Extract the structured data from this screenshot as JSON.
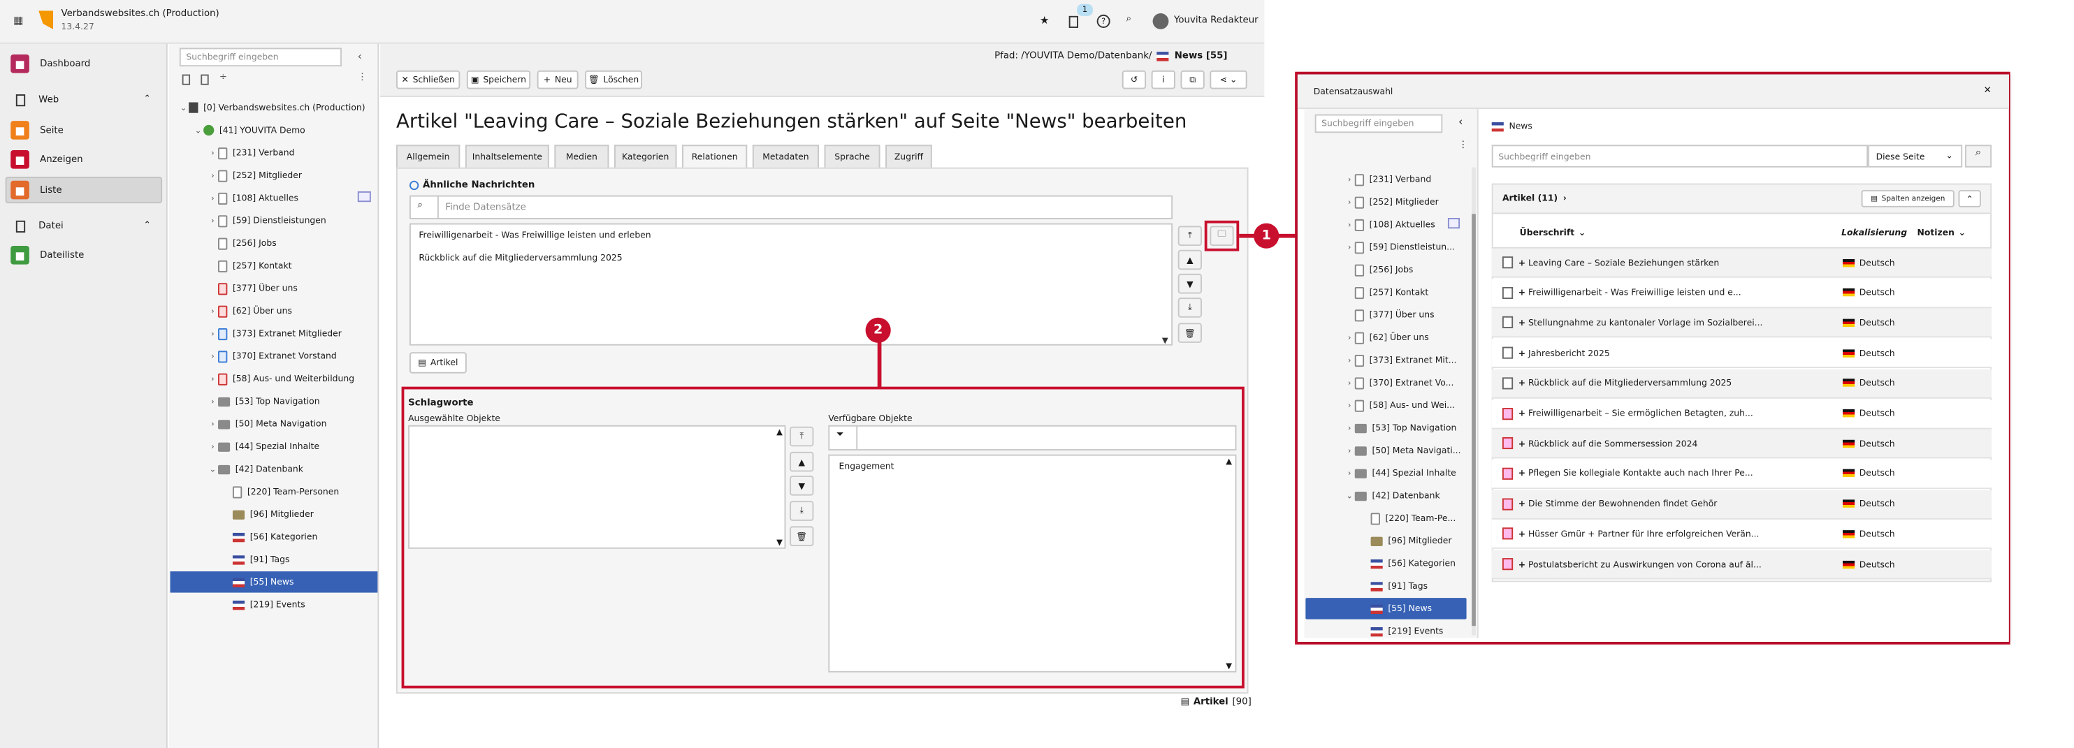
{
  "topbar": {
    "site_name": "Verbandswebsites.ch (Production)",
    "version": "13.4.27",
    "notif_count": "1",
    "user": "Youvita Redakteur"
  },
  "modules": [
    {
      "label": "Dashboard",
      "color": "#b52a5c",
      "icon": "dashboard-icon"
    },
    {
      "label": "Web",
      "color": "",
      "icon": "web-icon"
    },
    {
      "label": "Seite",
      "color": "#f0801a",
      "icon": "page-icon"
    },
    {
      "label": "Anzeigen",
      "color": "#c8102e",
      "icon": "eye-icon"
    },
    {
      "label": "Liste",
      "color": "#e26a2a",
      "icon": "list-icon"
    },
    {
      "label": "Datei",
      "color": "",
      "icon": "file-icon"
    },
    {
      "label": "Dateiliste",
      "color": "#3f9b3f",
      "icon": "filelist-icon"
    }
  ],
  "pagetree": {
    "search_placeholder": "Suchbegriff eingeben",
    "items": [
      {
        "label": "[0] Verbandswebsites.ch (Production)",
        "level": 0,
        "icon": "typo3-icon",
        "chev": "v"
      },
      {
        "label": "[41] YOUVITA Demo",
        "level": 1,
        "icon": "globe-icon",
        "chev": "v"
      },
      {
        "label": "[231] Verband",
        "level": 2,
        "icon": "page-icon",
        "chev": ">"
      },
      {
        "label": "[252] Mitglieder",
        "level": 2,
        "icon": "page-icon",
        "chev": ">"
      },
      {
        "label": "[108] Aktuelles",
        "level": 2,
        "icon": "page-icon",
        "chev": ">"
      },
      {
        "label": "[59] Dienstleistungen",
        "level": 2,
        "icon": "page-icon",
        "chev": ">"
      },
      {
        "label": "[256] Jobs",
        "level": 2,
        "icon": "page-icon",
        "chev": ""
      },
      {
        "label": "[257] Kontakt",
        "level": 2,
        "icon": "page-icon",
        "chev": ""
      },
      {
        "label": "[377] Über uns",
        "level": 2,
        "icon": "restricted-page-icon",
        "chev": ""
      },
      {
        "label": "[62] Über uns",
        "level": 2,
        "icon": "restricted-page-icon",
        "chev": ">"
      },
      {
        "label": "[373] Extranet Mitglieder",
        "level": 2,
        "icon": "extranet-icon",
        "chev": ">"
      },
      {
        "label": "[370] Extranet Vorstand",
        "level": 2,
        "icon": "extranet-icon",
        "chev": ">"
      },
      {
        "label": "[58] Aus- und Weiterbildung",
        "level": 2,
        "icon": "restricted-page-icon",
        "chev": ">"
      },
      {
        "label": "[53] Top Navigation",
        "level": 2,
        "icon": "folder-icon",
        "chev": ">"
      },
      {
        "label": "[50] Meta Navigation",
        "level": 2,
        "icon": "folder-icon",
        "chev": ">"
      },
      {
        "label": "[44] Spezial Inhalte",
        "level": 2,
        "icon": "folder-icon",
        "chev": ">"
      },
      {
        "label": "[42] Datenbank",
        "level": 2,
        "icon": "folder-icon",
        "chev": "v"
      },
      {
        "label": "[220] Team-Personen",
        "level": 3,
        "icon": "page-icon",
        "chev": ""
      },
      {
        "label": "[96] Mitglieder",
        "level": 3,
        "icon": "users-folder-icon",
        "chev": ""
      },
      {
        "label": "[56] Kategorien",
        "level": 3,
        "icon": "news-folder-icon",
        "chev": ""
      },
      {
        "label": "[91] Tags",
        "level": 3,
        "icon": "news-folder-icon",
        "chev": ""
      },
      {
        "label": "[55] News",
        "level": 3,
        "icon": "news-folder-icon",
        "chev": "",
        "selected": true
      },
      {
        "label": "[219] Events",
        "level": 3,
        "icon": "news-folder-icon",
        "chev": ""
      }
    ]
  },
  "doc": {
    "path_prefix": "Pfad: /YOUVITA Demo/Datenbank/",
    "path_page": "News [55]",
    "buttons": {
      "close": "Schließen",
      "save": "Speichern",
      "new": "Neu",
      "delete": "Löschen"
    },
    "title": "Artikel \"Leaving Care – Soziale Beziehungen stärken\" auf Seite \"News\" bearbeiten",
    "tabs": [
      "Allgemein",
      "Inhaltselemente",
      "Medien",
      "Kategorien",
      "Relationen",
      "Metadaten",
      "Sprache",
      "Zugriff"
    ],
    "active_tab": "Relationen",
    "related": {
      "label": "Ähnliche Nachrichten",
      "placeholder": "Finde Datensätze",
      "items": [
        "Freiwilligenarbeit - Was Freiwillige leisten und erleben",
        "Rückblick auf die Mitgliederversammlung 2025"
      ],
      "add_button": "Artikel"
    },
    "tags": {
      "label": "Schlagworte",
      "selected_label": "Ausgewählte Objekte",
      "available_label": "Verfügbare Objekte",
      "available_items": [
        "Engagement"
      ]
    },
    "footer_label": "Artikel",
    "footer_count": "[90]"
  },
  "badges": {
    "b1": "1",
    "b2": "2"
  },
  "modal": {
    "title": "Datensatzauswahl",
    "search_placeholder": "Suchbegriff eingeben",
    "tree": [
      {
        "label": "[231] Verband",
        "chev": ">"
      },
      {
        "label": "[252] Mitglieder",
        "chev": ">"
      },
      {
        "label": "[108] Aktuelles",
        "chev": ">"
      },
      {
        "label": "[59] Dienstleistun...",
        "chev": ">"
      },
      {
        "label": "[256] Jobs",
        "chev": ""
      },
      {
        "label": "[257] Kontakt",
        "chev": ""
      },
      {
        "label": "[377] Über uns",
        "chev": ""
      },
      {
        "label": "[62] Über uns",
        "chev": ">"
      },
      {
        "label": "[373] Extranet Mit...",
        "chev": ">"
      },
      {
        "label": "[370] Extranet Vo...",
        "chev": ">"
      },
      {
        "label": "[58] Aus- und Wei...",
        "chev": ">"
      },
      {
        "label": "[53] Top Navigation",
        "chev": ">"
      },
      {
        "label": "[50] Meta Navigati...",
        "chev": ">"
      },
      {
        "label": "[44] Spezial Inhalte",
        "chev": ">"
      },
      {
        "label": "[42] Datenbank",
        "chev": "v"
      },
      {
        "label": "[220] Team-Pe...",
        "chev": ""
      },
      {
        "label": "[96] Mitglieder",
        "chev": ""
      },
      {
        "label": "[56] Kategorien",
        "chev": ""
      },
      {
        "label": "[91] Tags",
        "chev": ""
      },
      {
        "label": "[55] News",
        "chev": "",
        "selected": true
      },
      {
        "label": "[219] Events",
        "chev": ""
      }
    ],
    "breadcrumb": "News",
    "list_search_placeholder": "Suchbegriff eingeben",
    "scope": "Diese Seite",
    "table_title": "Artikel (11)",
    "columns_button": "Spalten anzeigen",
    "col_title": "Überschrift",
    "col_locale": "Lokalisierung",
    "col_notes": "Notizen",
    "rows": [
      {
        "title": "Leaving Care – Soziale Beziehungen stärken",
        "lang": "Deutsch",
        "red": false
      },
      {
        "title": "Freiwilligenarbeit - Was Freiwillige leisten und e...",
        "lang": "Deutsch",
        "red": false
      },
      {
        "title": "Stellungnahme zu kantonaler Vorlage im Sozialberei...",
        "lang": "Deutsch",
        "red": false
      },
      {
        "title": "Jahresbericht 2025",
        "lang": "Deutsch",
        "red": false
      },
      {
        "title": "Rückblick auf die Mitgliederversammlung 2025",
        "lang": "Deutsch",
        "red": false
      },
      {
        "title": "Freiwilligenarbeit – Sie ermöglichen Betagten, zuh...",
        "lang": "Deutsch",
        "red": true
      },
      {
        "title": "Rückblick auf die Sommersession 2024",
        "lang": "Deutsch",
        "red": true
      },
      {
        "title": "Pflegen Sie kollegiale Kontakte auch nach Ihrer Pe...",
        "lang": "Deutsch",
        "red": true
      },
      {
        "title": "Die Stimme der Bewohnenden findet Gehör",
        "lang": "Deutsch",
        "red": true
      },
      {
        "title": "Hüsser Gmür + Partner für Ihre erfolgreichen Verän...",
        "lang": "Deutsch",
        "red": true
      },
      {
        "title": "Postulatsbericht zu Auswirkungen von Corona auf äl...",
        "lang": "Deutsch",
        "red": true
      }
    ]
  }
}
